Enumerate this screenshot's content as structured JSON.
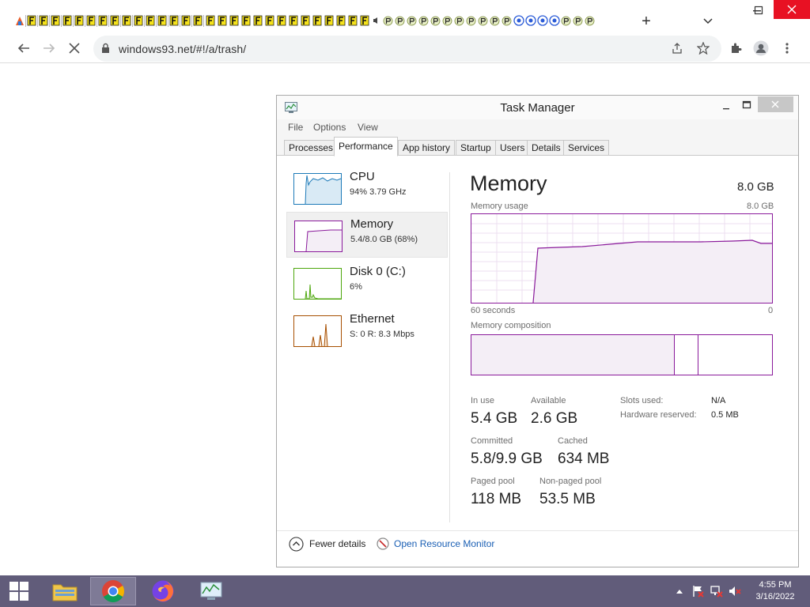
{
  "browser": {
    "url": "windows93.net/#!/a/trash/",
    "new_tab_label": "+",
    "tab_count": 49
  },
  "task_manager": {
    "title": "Task Manager",
    "menu": [
      "File",
      "Options",
      "View"
    ],
    "tabs": [
      "Processes",
      "Performance",
      "App history",
      "Startup",
      "Users",
      "Details",
      "Services"
    ],
    "active_tab": "Performance",
    "sidebar": [
      {
        "name": "CPU",
        "sub": "94%  3.79 GHz",
        "color": "#1d7ab8"
      },
      {
        "name": "Memory",
        "sub": "5.4/8.0 GB (68%)",
        "color": "#8a1a9b"
      },
      {
        "name": "Disk 0 (C:)",
        "sub": "6%",
        "color": "#4da60c"
      },
      {
        "name": "Ethernet",
        "sub": "S: 0 R: 8.3 Mbps",
        "color": "#a74f01"
      }
    ],
    "panel": {
      "title": "Memory",
      "total": "8.0 GB",
      "usage_label": "Memory usage",
      "usage_max": "8.0 GB",
      "time_left": "60 seconds",
      "time_right": "0",
      "composition_label": "Memory composition",
      "in_use_label": "In use",
      "in_use": "5.4 GB",
      "available_label": "Available",
      "available": "2.6 GB",
      "committed_label": "Committed",
      "committed": "5.8/9.9 GB",
      "cached_label": "Cached",
      "cached": "634 MB",
      "paged_label": "Paged pool",
      "paged": "118 MB",
      "nonpaged_label": "Non-paged pool",
      "nonpaged": "53.5 MB",
      "slots_label": "Slots used:",
      "slots": "N/A",
      "hw_label": "Hardware reserved:",
      "hw": "0.5 MB"
    },
    "footer": {
      "fewer_details": "Fewer details",
      "resource_monitor": "Open Resource Monitor"
    }
  },
  "taskbar": {
    "time": "4:55 PM",
    "date": "3/16/2022"
  },
  "colors": {
    "memory_accent": "#8a1a9b",
    "memory_fill": "#f4eef6",
    "taskbar": "#615c7a",
    "link": "#1a5fb4"
  }
}
